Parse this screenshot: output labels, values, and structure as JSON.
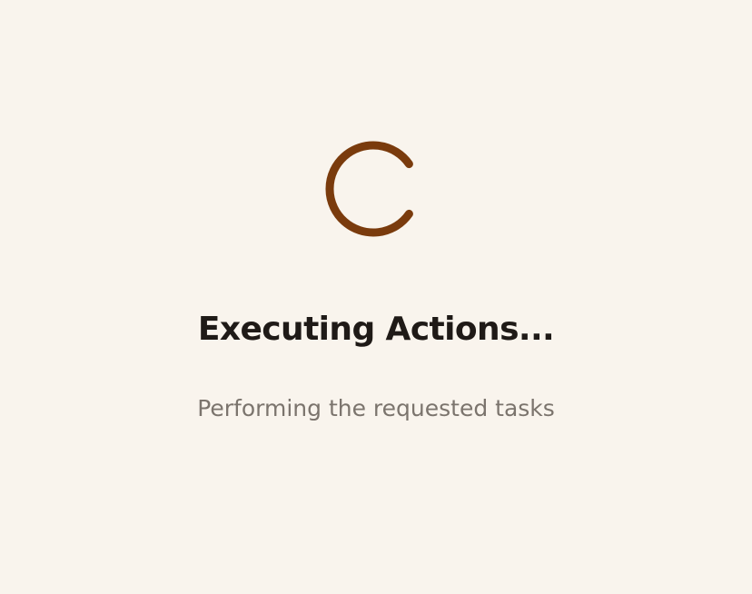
{
  "status": {
    "title": "Executing Actions...",
    "subtitle": "Performing the requested tasks"
  },
  "theme": {
    "background": "#f9f4ed",
    "accent": "#7a3b0d",
    "title_color": "#1f1a17",
    "subtitle_color": "#7b746d"
  },
  "icons": {
    "spinner": "loading-spinner-icon"
  }
}
